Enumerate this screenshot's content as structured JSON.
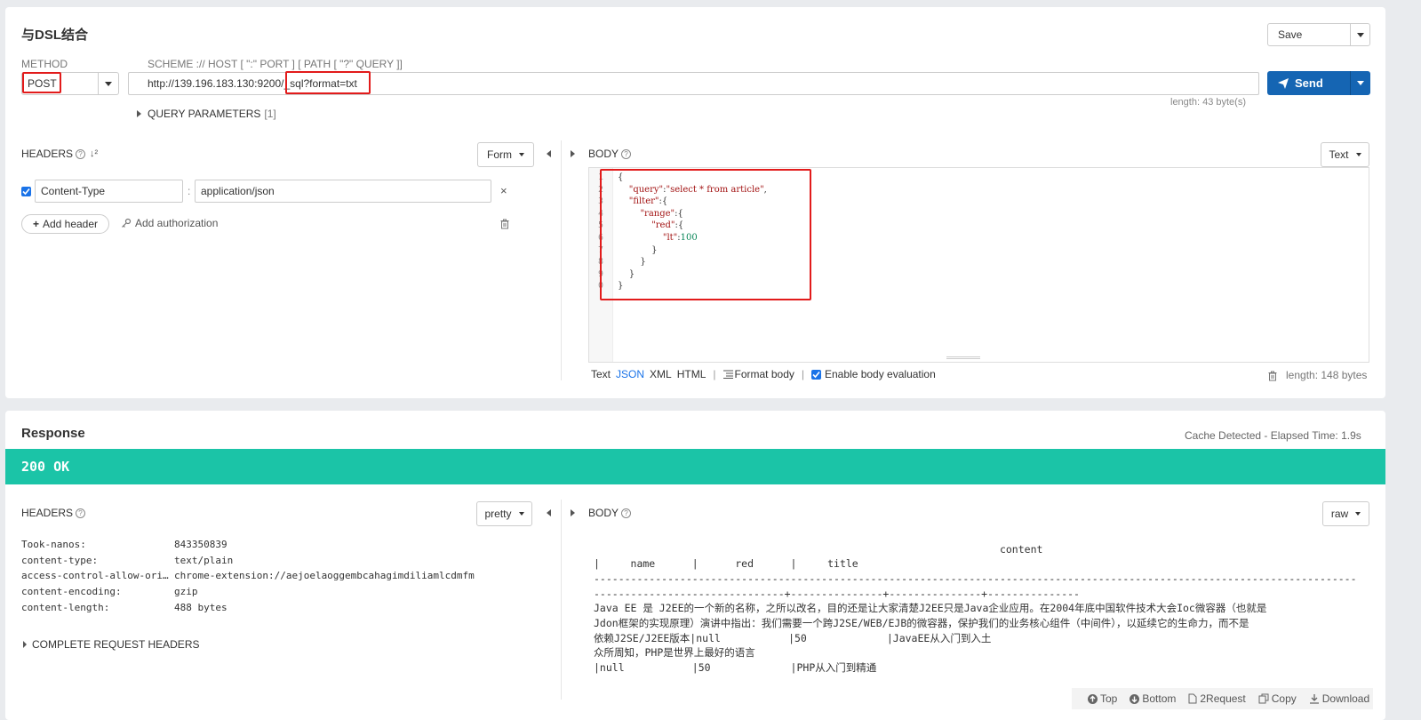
{
  "request": {
    "title": "与DSL结合",
    "save_label": "Save",
    "method_label": "METHOD",
    "method_value": "POST",
    "url_scheme_label": "SCHEME :// HOST [ \":\" PORT ] [ PATH [ \"?\" QUERY ]]",
    "url_base": "http://139.196.183.130:9200",
    "url_path": "/_sql?format=txt",
    "send_label": "Send",
    "length_label": "length: 43 byte(s)",
    "query_params_label": "QUERY PARAMETERS",
    "query_params_count": "[1]",
    "headers_label": "HEADERS",
    "headers_mode": "Form",
    "header_rows": [
      {
        "enabled": true,
        "name": "Content-Type",
        "value": "application/json"
      }
    ],
    "add_header_label": "Add header",
    "add_auth_label": "Add authorization",
    "body_label": "BODY",
    "body_mode": "Text",
    "body_lines": [
      {
        "n": "1",
        "text": "{"
      },
      {
        "n": "2",
        "text": "    \"query\":\"select * from article\","
      },
      {
        "n": "3",
        "text": "    \"filter\":{"
      },
      {
        "n": "4",
        "text": "        \"range\":{"
      },
      {
        "n": "5",
        "text": "            \"red\":{"
      },
      {
        "n": "6",
        "text": "                \"lt\":100"
      },
      {
        "n": "7",
        "text": "            }"
      },
      {
        "n": "8",
        "text": "        }"
      },
      {
        "n": "9",
        "text": "    }"
      },
      {
        "n": "0",
        "text": "}"
      }
    ],
    "body_formats": [
      "Text",
      "JSON",
      "XML",
      "HTML"
    ],
    "body_format_active": "JSON",
    "format_body_label": "Format body",
    "enable_eval_label": "Enable body evaluation",
    "body_length_label": "length: 148 bytes"
  },
  "response": {
    "title": "Response",
    "cache_label": "Cache Detected - Elapsed Time: 1.9s",
    "status": "200 OK",
    "status_color": "#1bc4a7",
    "headers_label": "HEADERS",
    "headers_mode": "pretty",
    "headers": [
      {
        "k": "Took-nanos:",
        "v": "843350839"
      },
      {
        "k": "content-type:",
        "v": "text/plain"
      },
      {
        "k": "access-control-allow-origin:",
        "v": "chrome-extension://aejoelaoggembcahagimdiliamlcdmfm"
      },
      {
        "k": "content-encoding:",
        "v": "gzip"
      },
      {
        "k": "content-length:",
        "v": "488 bytes"
      }
    ],
    "complete_headers_label": "COMPLETE REQUEST HEADERS",
    "body_label": "BODY",
    "body_mode": "raw",
    "body_lines": [
      "                                                                  content",
      "|     name      |      red      |     title",
      "----------------------------------------------------------------------------------------------------------------------------",
      "-------------------------------+---------------+---------------+---------------",
      "Java EE 是 J2EE的一个新的名称，之所以改名，目的还是让大家清楚J2EE只是Java企业应用。在2004年底中国软件技术大会Ioc微容器（也就是",
      "Jdon框架的实现原理）演讲中指出：我们需要一个跨J2SE/WEB/EJB的微容器，保护我们的业务核心组件（中间件），以延续它的生命力，而不是",
      "依赖J2SE/J2EE版本|null           |50             |JavaEE从入门到入土",
      "众所周知，PHP是世界上最好的语言",
      "|null           |50             |PHP从入门到精通"
    ],
    "footer": [
      "Top",
      "Bottom",
      "2Request",
      "Copy",
      "Download"
    ]
  }
}
